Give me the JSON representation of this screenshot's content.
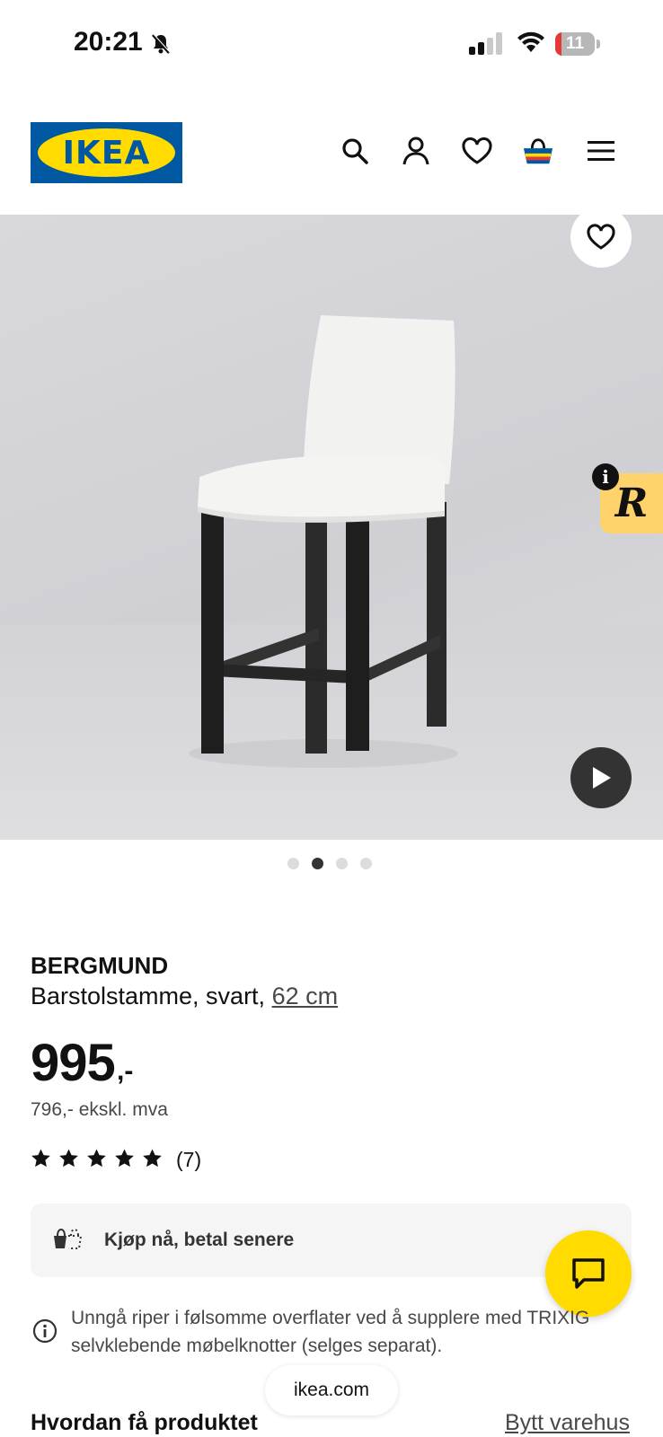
{
  "status_bar": {
    "time": "20:21",
    "battery": "11"
  },
  "header": {
    "logo_text": "IKEA"
  },
  "product": {
    "name": "BERGMUND",
    "description_prefix": "Barstolstamme, svart,",
    "size_link": "62 cm",
    "price": "995",
    "price_suffix": ",-",
    "price_ex_vat": "796,- ekskl. mva",
    "rating": {
      "stars": 5,
      "count_label": "(7)"
    }
  },
  "gallery": {
    "total_images": 4,
    "active_index": 1
  },
  "klarna": {
    "label": "Kjøp nå, betal senere"
  },
  "tip": {
    "text": "Unngå riper i følsomme overflater ved å supplere med TRIXIG selvklebende møbelknotter (selges separat)."
  },
  "url_bar": {
    "domain": "ikea.com"
  },
  "delivery": {
    "heading": "Hvordan få produktet",
    "change_store": "Bytt varehus"
  },
  "overlay_tab": {
    "letter": "R",
    "info": "i"
  },
  "colors": {
    "ikea_blue": "#0058a3",
    "ikea_yellow": "#ffdb00",
    "text": "#111111"
  }
}
